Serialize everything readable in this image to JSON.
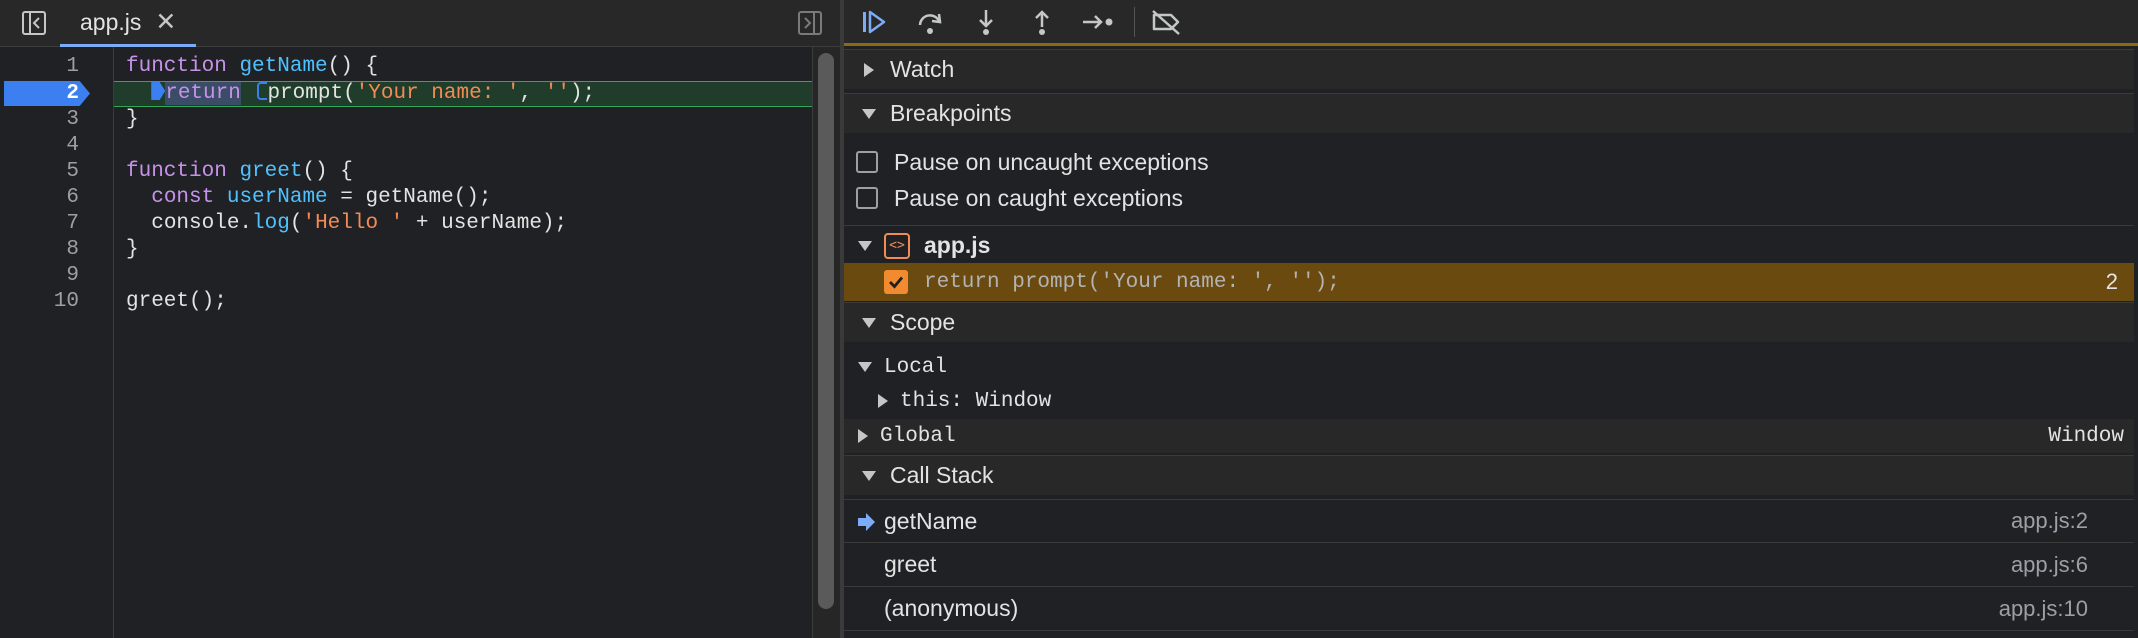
{
  "editor": {
    "tab_label": "app.js",
    "close_glyph": "✕",
    "line_numbers": [
      "1",
      "2",
      "3",
      "4",
      "5",
      "6",
      "7",
      "8",
      "9",
      "10"
    ],
    "active_line": "2",
    "code": {
      "l1_kw": "function",
      "l1_fn": "getName",
      "l1_rest": "() {",
      "l2_kw": "return",
      "l2_fn": "prompt(",
      "l2_str1": "'Your name: '",
      "l2_mid": ", ",
      "l2_str2": "''",
      "l2_end": ");",
      "l3": "}",
      "l5_kw": "function",
      "l5_fn": "greet",
      "l5_rest": "() {",
      "l6_kw": "const",
      "l6_var": "userName",
      "l6_rest": " = getName();",
      "l7_obj": "console.",
      "l7_fn": "log",
      "l7_open": "(",
      "l7_str": "'Hello '",
      "l7_rest": " + userName);",
      "l8": "}",
      "l10": "greet();"
    }
  },
  "debugger": {
    "watch_title": "Watch",
    "breakpoints_title": "Breakpoints",
    "pause_uncaught": "Pause on uncaught exceptions",
    "pause_caught": "Pause on caught exceptions",
    "bp_file": "app.js",
    "bp_file_icon_glyph": "<>",
    "bp_entry_code": "return prompt('Your name: ', '');",
    "bp_entry_line": "2",
    "scope_title": "Scope",
    "local_label": "Local",
    "this_key": "this",
    "this_sep": ": ",
    "this_val": "Window",
    "global_label": "Global",
    "global_val": "Window",
    "callstack_title": "Call Stack",
    "frames": [
      {
        "fn": "getName",
        "loc": "app.js:2"
      },
      {
        "fn": "greet",
        "loc": "app.js:6"
      },
      {
        "fn": "(anonymous)",
        "loc": "app.js:10"
      }
    ]
  },
  "colors": {
    "accent": "#3b7ff0",
    "breakpoint_bg": "#6b4a10",
    "paused_bar": "#8a6a13",
    "string": "#f28b54",
    "keyword": "#c792ea"
  }
}
